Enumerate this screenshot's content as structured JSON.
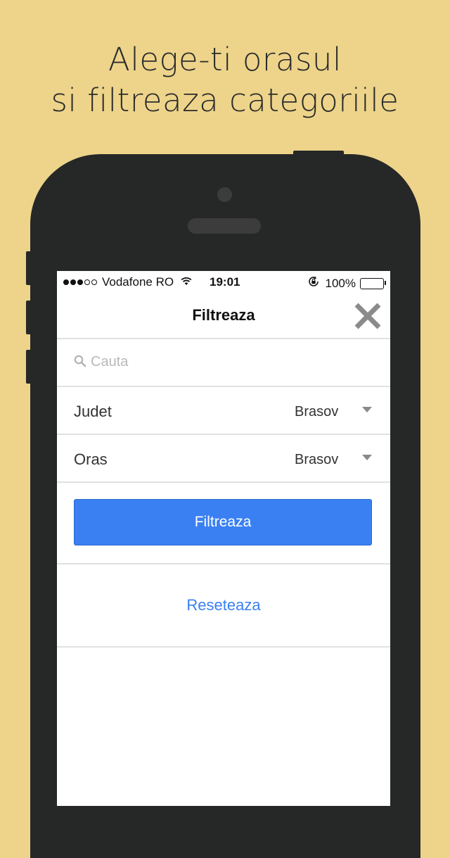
{
  "headline": {
    "line1": "Alege-ti orasul",
    "line2": "si filtreaza categoriile"
  },
  "status_bar": {
    "carrier": "Vodafone RO",
    "time": "19:01",
    "battery": "100%",
    "battery_level": 1.0,
    "signal_bars": 3,
    "signal_total": 5
  },
  "nav": {
    "title": "Filtreaza",
    "close_icon": "close-icon"
  },
  "search": {
    "placeholder": "Cauta",
    "value": ""
  },
  "filters": [
    {
      "label": "Judet",
      "value": "Brasov"
    },
    {
      "label": "Oras",
      "value": "Brasov"
    }
  ],
  "actions": {
    "filter_label": "Filtreaza",
    "reset_label": "Reseteaza"
  },
  "colors": {
    "background": "#EDD48A",
    "phone": "#262727",
    "accent": "#3A80F2"
  }
}
